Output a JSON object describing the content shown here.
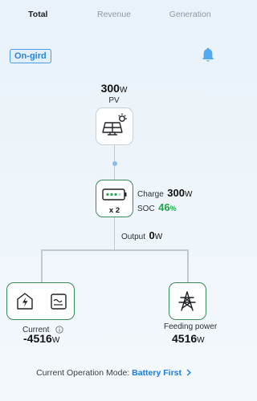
{
  "tabs": [
    {
      "label": "Total",
      "active": true
    },
    {
      "label": "Revenue",
      "active": false
    },
    {
      "label": "Generation",
      "active": false
    }
  ],
  "status_badge": "On-gird",
  "pv": {
    "value": "300",
    "unit": "W",
    "label": "PV"
  },
  "battery": {
    "count": "x 2",
    "charge_label": "Charge",
    "charge_value": "300",
    "charge_unit": "W",
    "soc_label": "SOC",
    "soc_value": "46",
    "soc_unit": "%"
  },
  "output": {
    "label": "Output",
    "value": "0",
    "unit": "W"
  },
  "grid": {
    "label": "Current",
    "value": "-4516",
    "unit": "W"
  },
  "feeding": {
    "label": "Feeding power",
    "value": "4516",
    "unit": "W"
  },
  "mode": {
    "label": "Current Operation Mode:",
    "value": "Battery First"
  },
  "colors": {
    "accent_blue": "#2a83df",
    "soc_green": "#1fa84a",
    "node_border_green": "#3a8a58"
  },
  "icons": [
    "bell-icon",
    "solar-panel-icon",
    "battery-icon",
    "inverter-icon",
    "ac-wave-icon",
    "info-icon",
    "transmission-tower-icon",
    "chevron-right-icon"
  ]
}
